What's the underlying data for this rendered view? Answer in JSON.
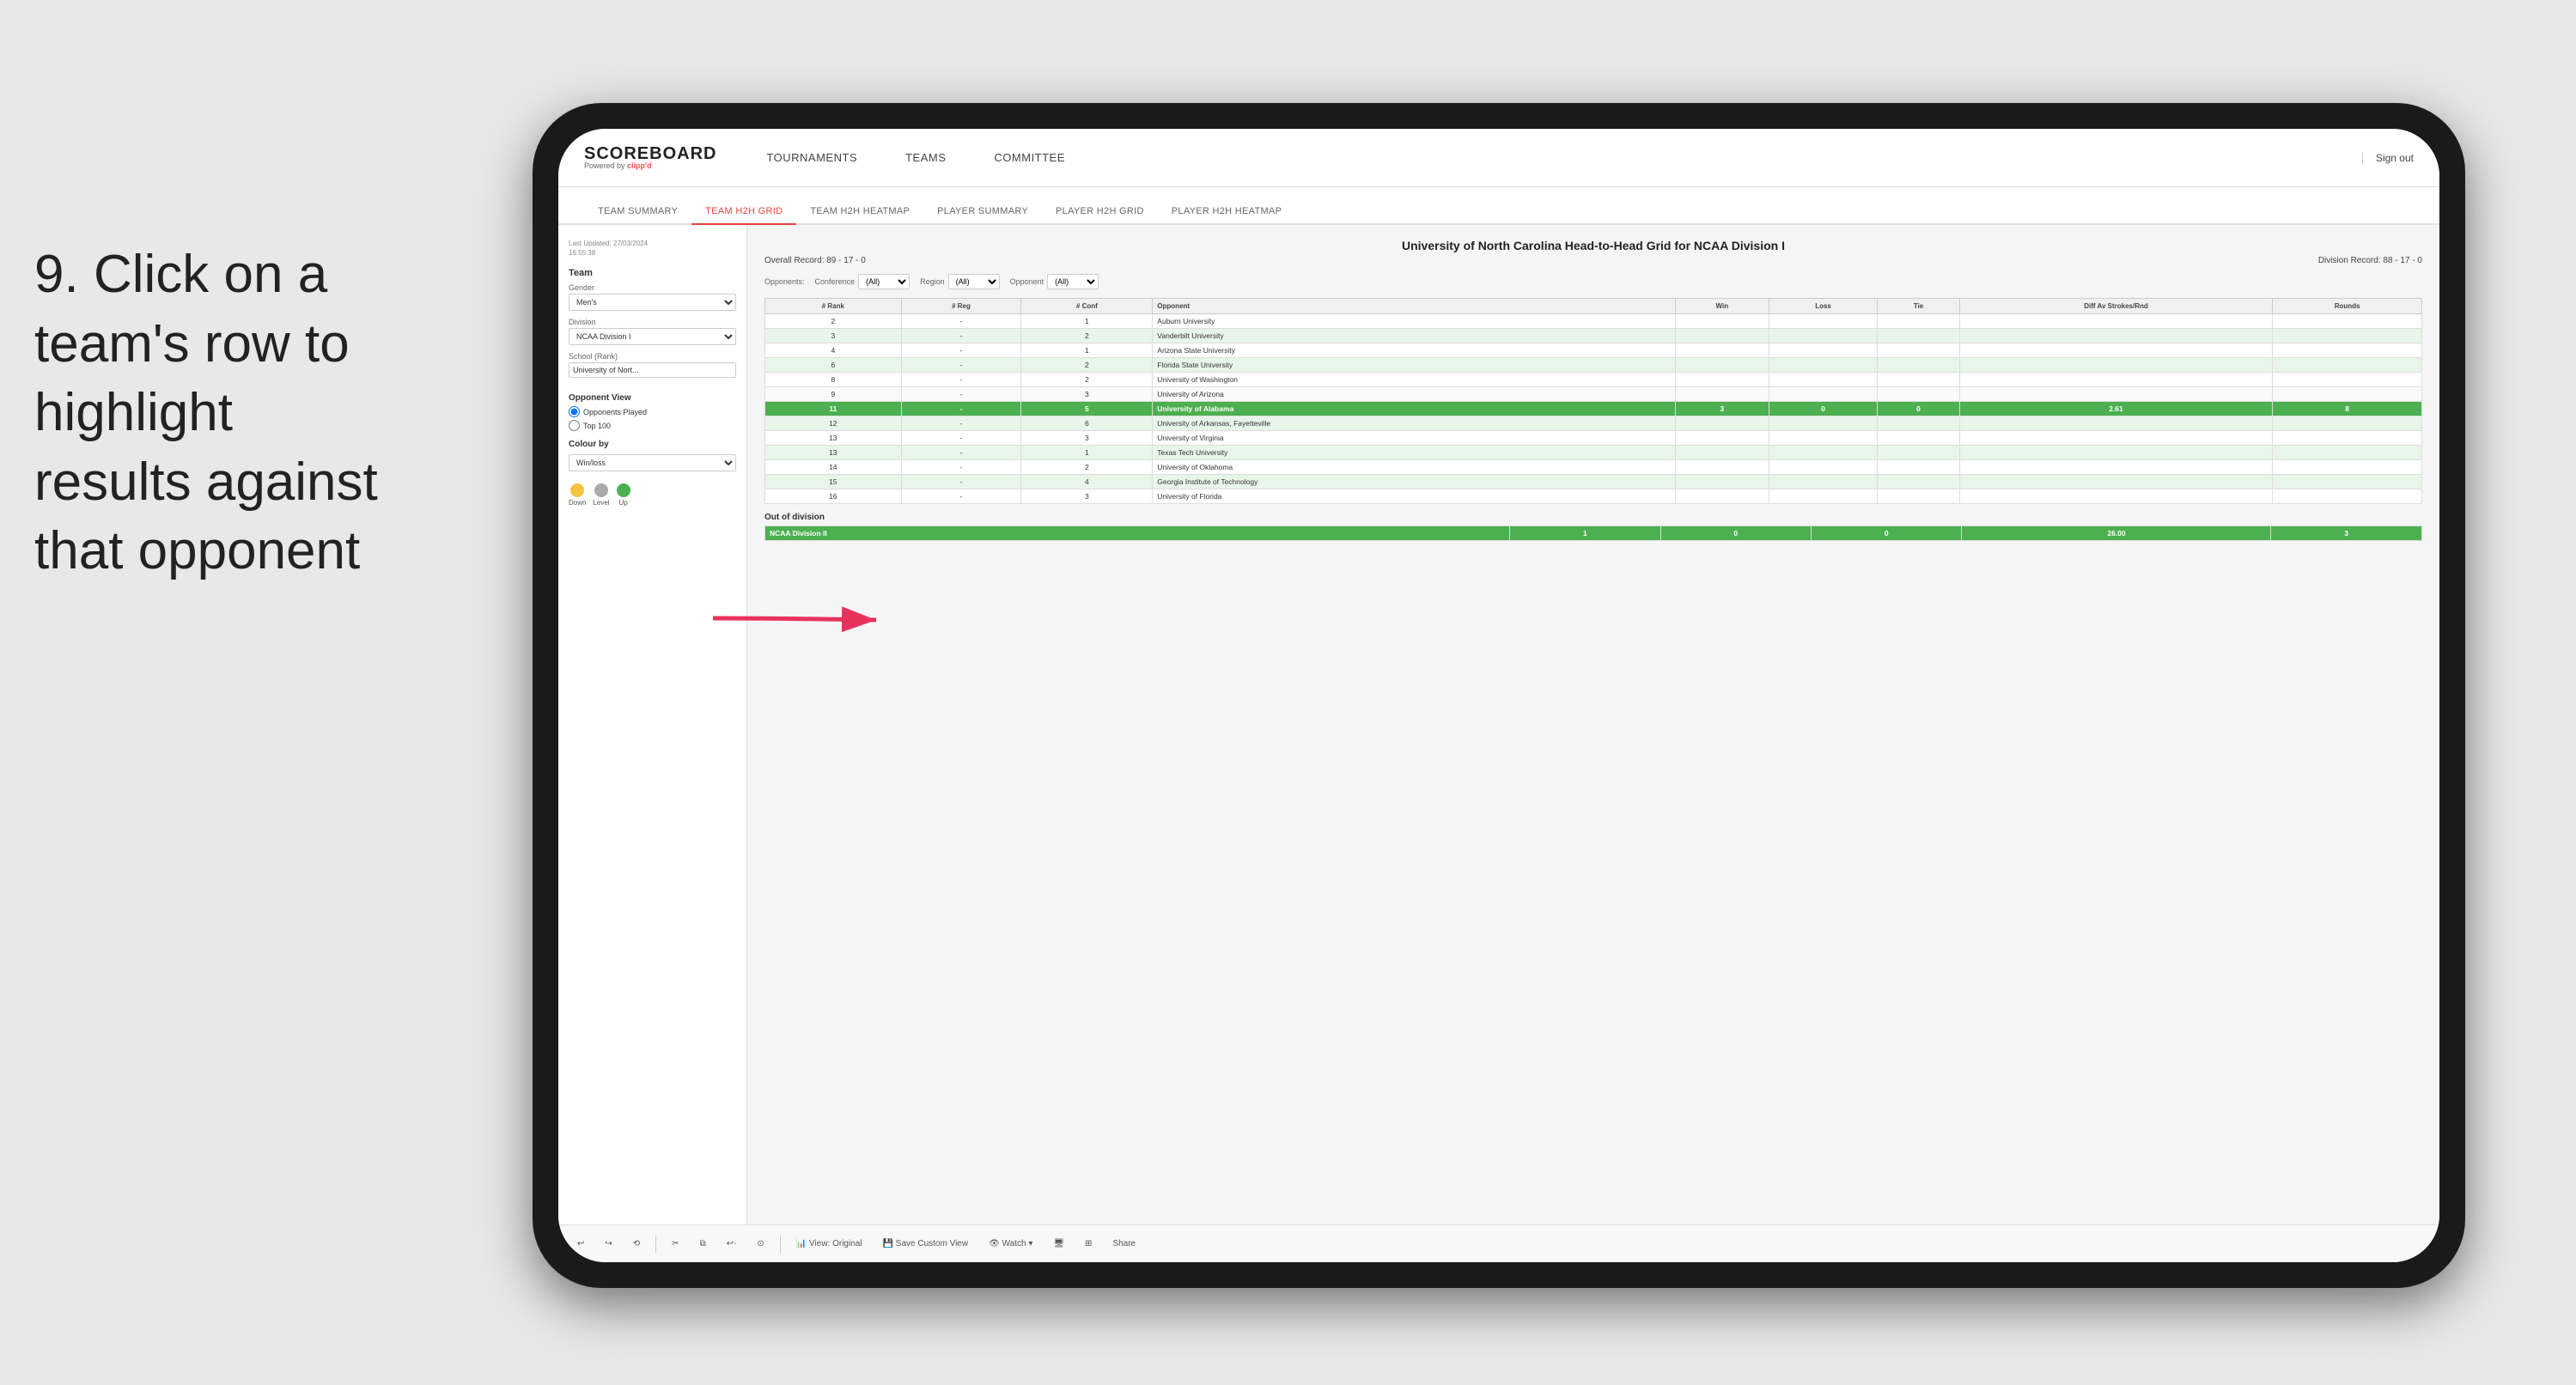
{
  "instruction": {
    "step": "9.",
    "text": "Click on a team's row to highlight results against that opponent"
  },
  "nav": {
    "logo": "SCOREBOARD",
    "logo_powered": "Powered by clipp'd",
    "items": [
      "TOURNAMENTS",
      "TEAMS",
      "COMMITTEE"
    ],
    "sign_out": "Sign out"
  },
  "sub_nav": {
    "items": [
      "TEAM SUMMARY",
      "TEAM H2H GRID",
      "TEAM H2H HEATMAP",
      "PLAYER SUMMARY",
      "PLAYER H2H GRID",
      "PLAYER H2H HEATMAP"
    ],
    "active": "TEAM H2H GRID"
  },
  "sidebar": {
    "last_updated": "Last Updated: 27/03/2024\n16:55:38",
    "team_label": "Team",
    "gender_label": "Gender",
    "gender_value": "Men's",
    "division_label": "Division",
    "division_value": "NCAA Division I",
    "school_label": "School (Rank)",
    "school_value": "University of Nort...",
    "opponent_view_label": "Opponent View",
    "radio_opponents": "Opponents Played",
    "radio_top100": "Top 100",
    "colour_by_label": "Colour by",
    "colour_by_value": "Win/loss",
    "legend": [
      {
        "label": "Down",
        "color": "#f5c542"
      },
      {
        "label": "Level",
        "color": "#aaa"
      },
      {
        "label": "Up",
        "color": "#4caf50"
      }
    ]
  },
  "grid": {
    "title": "University of North Carolina Head-to-Head Grid for NCAA Division I",
    "overall_record": "Overall Record: 89 - 17 - 0",
    "division_record": "Division Record: 88 - 17 - 0",
    "filters": {
      "opponents_label": "Opponents:",
      "conference_label": "Conference",
      "conference_value": "(All)",
      "region_label": "Region",
      "region_value": "(All)",
      "opponent_label": "Opponent",
      "opponent_value": "(All)"
    },
    "columns": [
      "# Rank",
      "# Reg",
      "# Conf",
      "Opponent",
      "Win",
      "Loss",
      "Tie",
      "Diff Av Strokes/Rnd",
      "Rounds"
    ],
    "rows": [
      {
        "rank": "2",
        "reg": "-",
        "conf": "1",
        "opponent": "Auburn University",
        "win": "",
        "loss": "",
        "tie": "",
        "diff": "",
        "rounds": "",
        "style": "normal"
      },
      {
        "rank": "3",
        "reg": "-",
        "conf": "2",
        "opponent": "Vanderbilt University",
        "win": "",
        "loss": "",
        "tie": "",
        "diff": "",
        "rounds": "",
        "style": "light-green"
      },
      {
        "rank": "4",
        "reg": "-",
        "conf": "1",
        "opponent": "Arizona State University",
        "win": "",
        "loss": "",
        "tie": "",
        "diff": "",
        "rounds": "",
        "style": "normal"
      },
      {
        "rank": "6",
        "reg": "-",
        "conf": "2",
        "opponent": "Florida State University",
        "win": "",
        "loss": "",
        "tie": "",
        "diff": "",
        "rounds": "",
        "style": "light-green"
      },
      {
        "rank": "8",
        "reg": "-",
        "conf": "2",
        "opponent": "University of Washington",
        "win": "",
        "loss": "",
        "tie": "",
        "diff": "",
        "rounds": "",
        "style": "normal"
      },
      {
        "rank": "9",
        "reg": "-",
        "conf": "3",
        "opponent": "University of Arizona",
        "win": "",
        "loss": "",
        "tie": "",
        "diff": "",
        "rounds": "",
        "style": "normal"
      },
      {
        "rank": "11",
        "reg": "-",
        "conf": "5",
        "opponent": "University of Alabama",
        "win": "3",
        "loss": "0",
        "tie": "0",
        "diff": "2.61",
        "rounds": "8",
        "style": "highlighted"
      },
      {
        "rank": "12",
        "reg": "-",
        "conf": "6",
        "opponent": "University of Arkansas, Fayetteville",
        "win": "",
        "loss": "",
        "tie": "",
        "diff": "",
        "rounds": "",
        "style": "light-green"
      },
      {
        "rank": "13",
        "reg": "-",
        "conf": "3",
        "opponent": "University of Virginia",
        "win": "",
        "loss": "",
        "tie": "",
        "diff": "",
        "rounds": "",
        "style": "normal"
      },
      {
        "rank": "13",
        "reg": "-",
        "conf": "1",
        "opponent": "Texas Tech University",
        "win": "",
        "loss": "",
        "tie": "",
        "diff": "",
        "rounds": "",
        "style": "light-green"
      },
      {
        "rank": "14",
        "reg": "-",
        "conf": "2",
        "opponent": "University of Oklahoma",
        "win": "",
        "loss": "",
        "tie": "",
        "diff": "",
        "rounds": "",
        "style": "normal"
      },
      {
        "rank": "15",
        "reg": "-",
        "conf": "4",
        "opponent": "Georgia Institute of Technology",
        "win": "",
        "loss": "",
        "tie": "",
        "diff": "",
        "rounds": "",
        "style": "light-green"
      },
      {
        "rank": "16",
        "reg": "-",
        "conf": "3",
        "opponent": "University of Florida",
        "win": "",
        "loss": "",
        "tie": "",
        "diff": "",
        "rounds": "",
        "style": "normal"
      }
    ],
    "out_of_division_label": "Out of division",
    "out_of_division_row": {
      "name": "NCAA Division II",
      "win": "1",
      "loss": "0",
      "tie": "0",
      "diff": "26.00",
      "rounds": "3"
    }
  },
  "toolbar": {
    "buttons": [
      "↩",
      "↪",
      "⟲",
      "✂",
      "⧉",
      "↩·",
      "⊙",
      "View: Original",
      "Save Custom View",
      "Watch ▾",
      "🖥",
      "⊞",
      "Share"
    ]
  }
}
